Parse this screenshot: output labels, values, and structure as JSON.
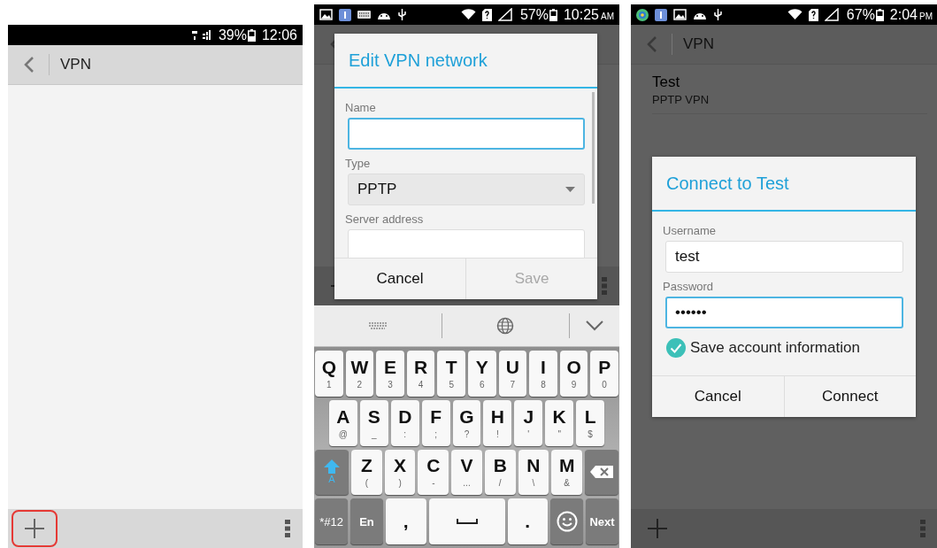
{
  "screens": [
    {
      "dimmed": false,
      "status_bar": {
        "battery": "39%",
        "time": "12:06"
      },
      "action_bar": {
        "title": "VPN"
      },
      "bottom_bar": {
        "add_highlighted": true
      }
    },
    {
      "dimmed": true,
      "status_bar": {
        "battery": "57%",
        "time": "10:25",
        "period": "AM"
      },
      "bottom_bar": {
        "add_highlighted": false
      },
      "dialog": {
        "kind": "edit",
        "title": "Edit VPN network",
        "fields": [
          {
            "kind": "text",
            "label": "Name",
            "focused": true
          },
          {
            "kind": "select",
            "label": "Type",
            "value": "PPTP",
            "focused": false
          },
          {
            "kind": "text",
            "label": "Server address",
            "focused": false
          }
        ],
        "buttons": [
          {
            "label": "Cancel",
            "disabled": false
          },
          {
            "label": "Save",
            "disabled": true
          }
        ]
      },
      "keyboard": {
        "rows": [
          {
            "keys": [
              {
                "kind": "char",
                "main": "Q",
                "sub": "1"
              },
              {
                "kind": "char",
                "main": "W",
                "sub": "2"
              },
              {
                "kind": "char",
                "main": "E",
                "sub": "3"
              },
              {
                "kind": "char",
                "main": "R",
                "sub": "4"
              },
              {
                "kind": "char",
                "main": "T",
                "sub": "5"
              },
              {
                "kind": "char",
                "main": "Y",
                "sub": "6"
              },
              {
                "kind": "char",
                "main": "U",
                "sub": "7"
              },
              {
                "kind": "char",
                "main": "I",
                "sub": "8"
              },
              {
                "kind": "char",
                "main": "O",
                "sub": "9"
              },
              {
                "kind": "char",
                "main": "P",
                "sub": "0"
              }
            ]
          },
          {
            "keys": [
              {
                "kind": "char",
                "main": "A",
                "sub": "@"
              },
              {
                "kind": "char",
                "main": "S",
                "sub": "_"
              },
              {
                "kind": "char",
                "main": "D",
                "sub": ":"
              },
              {
                "kind": "char",
                "main": "F",
                "sub": ";"
              },
              {
                "kind": "char",
                "main": "G",
                "sub": "?"
              },
              {
                "kind": "char",
                "main": "H",
                "sub": "!"
              },
              {
                "kind": "char",
                "main": "J",
                "sub": "'"
              },
              {
                "kind": "char",
                "main": "K",
                "sub": "\""
              },
              {
                "kind": "char",
                "main": "L",
                "sub": "$"
              }
            ]
          },
          {
            "keys": [
              {
                "kind": "shift",
                "main": "A"
              },
              {
                "kind": "char",
                "main": "Z",
                "sub": "("
              },
              {
                "kind": "char",
                "main": "X",
                "sub": ")"
              },
              {
                "kind": "char",
                "main": "C",
                "sub": "-"
              },
              {
                "kind": "char",
                "main": "V",
                "sub": "..."
              },
              {
                "kind": "char",
                "main": "B",
                "sub": "/"
              },
              {
                "kind": "char",
                "main": "N",
                "sub": "\\"
              },
              {
                "kind": "char",
                "main": "M",
                "sub": "&"
              },
              {
                "kind": "backspace"
              }
            ]
          },
          {
            "keys": [
              {
                "kind": "func",
                "main": "*#12"
              },
              {
                "kind": "func",
                "main": "En"
              },
              {
                "kind": "char",
                "main": ","
              },
              {
                "kind": "space"
              },
              {
                "kind": "char",
                "main": "."
              },
              {
                "kind": "emoji"
              },
              {
                "kind": "func",
                "main": "Next"
              }
            ]
          }
        ]
      }
    },
    {
      "dimmed": true,
      "status_bar": {
        "battery": "67%",
        "time": "2:04",
        "period": "PM"
      },
      "action_bar": {
        "title": "VPN"
      },
      "vpn_list": [
        {
          "name": "Test",
          "type": "PPTP VPN"
        }
      ],
      "bottom_bar": {
        "add_highlighted": false
      },
      "dialog": {
        "kind": "connect",
        "title": "Connect to Test",
        "fields": [
          {
            "kind": "text",
            "label": "Username",
            "value": "test",
            "focused": false
          },
          {
            "kind": "text",
            "label": "Password",
            "value": "••••••",
            "focused": true
          },
          {
            "kind": "checkbox",
            "label": "Save account information",
            "checked": true
          }
        ],
        "buttons": [
          {
            "label": "Cancel",
            "disabled": false
          },
          {
            "label": "Connect",
            "disabled": false
          }
        ]
      }
    }
  ]
}
